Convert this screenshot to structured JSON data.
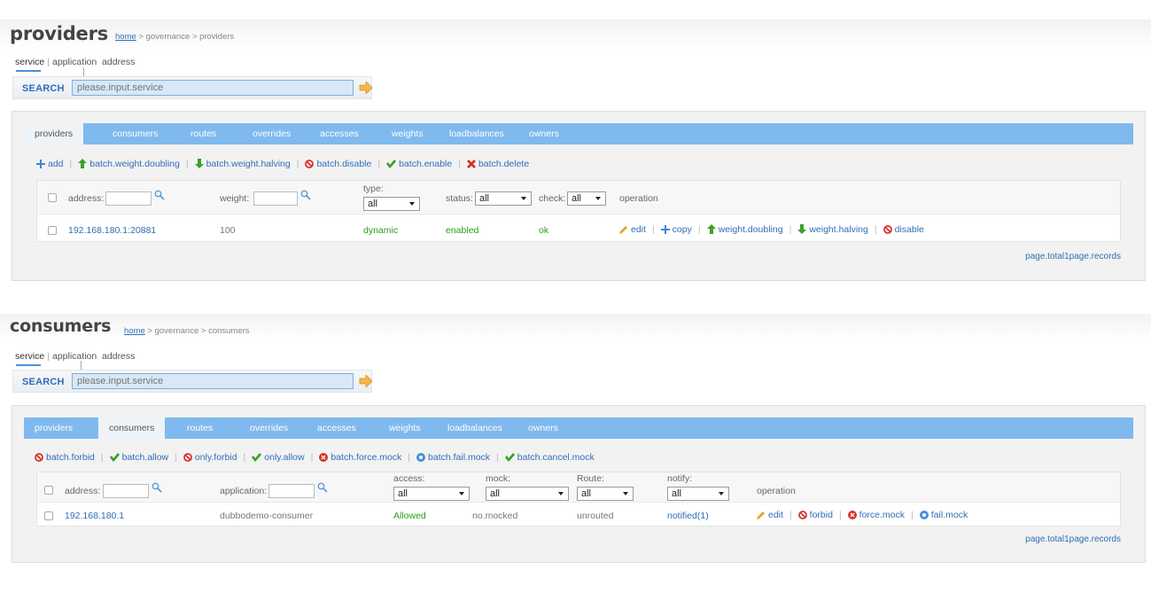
{
  "colors": {
    "accent": "#2f6fb5",
    "tabbar": "#7fb9ee",
    "success": "#2e9a1e",
    "danger": "#d9332c"
  },
  "providers_page": {
    "title": "providers",
    "breadcrumb": {
      "home": "home",
      "rest": " > governance > providers"
    },
    "scope_tabs": {
      "service": "service",
      "application": "application",
      "address": "address"
    },
    "search": {
      "label": "SEARCH",
      "placeholder": "please.input.service"
    },
    "tabs": [
      "providers",
      "consumers",
      "routes",
      "overrides",
      "accesses",
      "weights",
      "loadbalances",
      "owners"
    ],
    "actions": {
      "add": "add",
      "weight_doubling": "batch.weight.doubling",
      "weight_halving": "batch.weight.halving",
      "disable": "batch.disable",
      "enable": "batch.enable",
      "delete": "batch.delete"
    },
    "columns": {
      "address": "address:",
      "weight": "weight:",
      "type": "type:",
      "status": "status:",
      "check": "check:",
      "operation": "operation"
    },
    "filters": {
      "type": "all",
      "status": "all",
      "check": "all"
    },
    "row": {
      "address": "192.168.180.1:20881",
      "weight": "100",
      "type": "dynamic",
      "status": "enabled",
      "check": "ok"
    },
    "ops": {
      "edit": "edit",
      "copy": "copy",
      "doubling": "weight.doubling",
      "halving": "weight.halving",
      "disable": "disable"
    },
    "pager": "page.total1page.records"
  },
  "consumers_page": {
    "title": "consumers",
    "breadcrumb": {
      "home": "home",
      "rest": " > governance > consumers"
    },
    "scope_tabs": {
      "service": "service",
      "application": "application",
      "address": "address"
    },
    "search": {
      "label": "SEARCH",
      "placeholder": "please.input.service"
    },
    "tabs": [
      "providers",
      "consumers",
      "routes",
      "overrides",
      "accesses",
      "weights",
      "loadbalances",
      "owners"
    ],
    "actions": {
      "forbid": "batch.forbid",
      "allow": "batch.allow",
      "only_forbid": "only.forbid",
      "only_allow": "only.allow",
      "force_mock": "batch.force.mock",
      "fail_mock": "batch.fail.mock",
      "cancel_mock": "batch.cancel.mock"
    },
    "columns": {
      "address": "address:",
      "application": "application:",
      "access": "access:",
      "mock": "mock:",
      "route": "Route:",
      "notify": "notify:",
      "operation": "operation"
    },
    "filters": {
      "access": "all",
      "mock": "all",
      "route": "all",
      "notify": "all"
    },
    "row": {
      "address": "192.168.180.1",
      "application": "dubbodemo-consumer",
      "access": "Allowed",
      "mock": "no.mocked",
      "route": "unrouted",
      "notify": "notified(1)"
    },
    "ops": {
      "edit": "edit",
      "forbid": "forbid",
      "force_mock": "force.mock",
      "fail_mock": "fail.mock"
    },
    "pager": "page.total1page.records"
  }
}
